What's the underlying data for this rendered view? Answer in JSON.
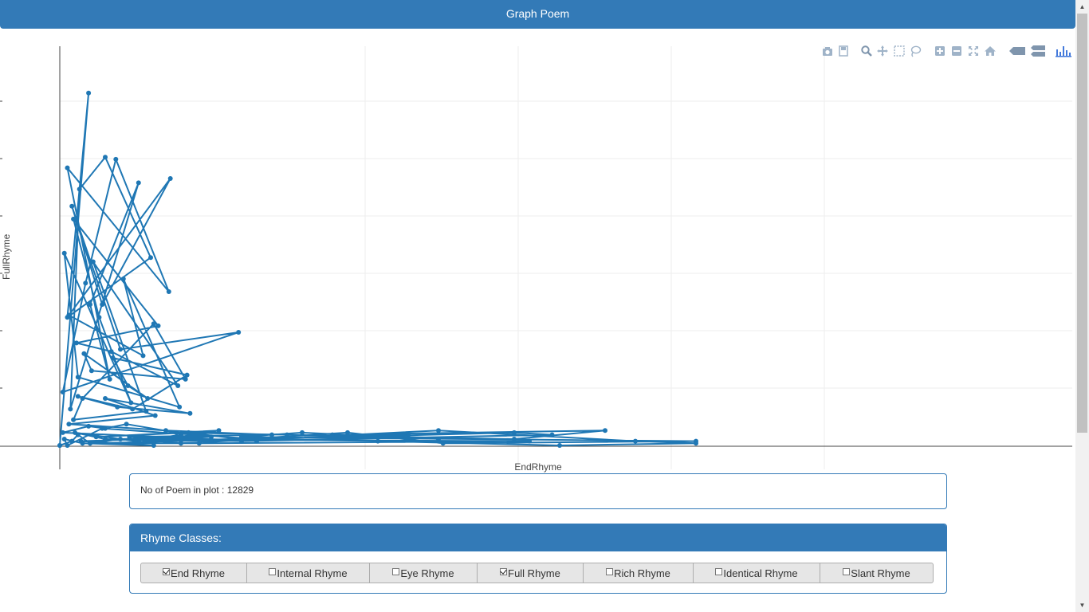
{
  "header": {
    "title": "Graph Poem"
  },
  "colors": {
    "accent": "#337ab7",
    "series": "#1f77b4",
    "grid": "#eeeeee"
  },
  "modebar": {
    "icons": [
      "camera-icon",
      "save-icon",
      "zoom-icon",
      "pan-icon",
      "box-select-icon",
      "lasso-icon",
      "zoom-in-icon",
      "zoom-out-icon",
      "autoscale-icon",
      "reset-axes-icon",
      "spike-lines-icon",
      "compare-hover-icon",
      "plotly-logo-icon"
    ]
  },
  "chart_data": {
    "type": "line",
    "xlabel": "EndRhyme",
    "ylabel": "FullRhyme",
    "grid": true,
    "series": [
      {
        "x": [
          0,
          19,
          5,
          60,
          30,
          13,
          7,
          52,
          20,
          33,
          5,
          72,
          37,
          17,
          2,
          118,
          40,
          8,
          28,
          73,
          6,
          55,
          42,
          79,
          12,
          3,
          47,
          26,
          9,
          65,
          11,
          34,
          78,
          22,
          57,
          9,
          15,
          62,
          83,
          21,
          16,
          58,
          45,
          35,
          84,
          48,
          12,
          38,
          86,
          30,
          63,
          6,
          70,
          140,
          46,
          100,
          190,
          253,
          420,
          120,
          160,
          250,
          180,
          360,
          300,
          150,
          77,
          44,
          30,
          19,
          2,
          130,
          85,
          24,
          105,
          62,
          230,
          56,
          80,
          50,
          10,
          30,
          310,
          92,
          20,
          300,
          325,
          120,
          50,
          80,
          250,
          380,
          420,
          330,
          210,
          130,
          28,
          5,
          3,
          15,
          62,
          14,
          100,
          40,
          20,
          12,
          8,
          0
        ],
        "y": [
          0,
          165,
          60,
          88,
          135,
          120,
          17,
          123,
          66,
          31,
          130,
          72,
          134,
          76,
          25,
          53,
          45,
          112,
          66,
          125,
          61,
          42,
          78,
          18,
          32,
          90,
          20,
          60,
          106,
          56,
          48,
          44,
          28,
          86,
          16,
          12,
          22,
          57,
          31,
          35,
          43,
          22,
          28,
          41,
          33,
          17,
          23,
          18,
          15,
          22,
          14,
          10,
          7,
          5,
          4,
          2,
          6,
          1,
          2,
          4,
          6,
          3,
          5,
          7,
          3,
          5,
          6,
          10,
          8,
          9,
          6,
          2,
          6,
          4,
          7,
          2,
          5,
          2,
          5,
          2,
          6,
          3,
          2,
          1,
          1,
          6,
          5,
          2,
          3,
          1,
          7,
          2,
          1,
          0,
          2,
          3,
          8,
          0,
          3,
          1,
          0,
          2,
          4,
          3,
          1,
          5,
          2,
          0
        ]
      }
    ]
  },
  "info": {
    "label": "No of Poem in plot : 12829"
  },
  "rhyme_classes": {
    "title": "Rhyme Classes:",
    "options": [
      {
        "label": "End Rhyme",
        "checked": true
      },
      {
        "label": "Internal Rhyme",
        "checked": false
      },
      {
        "label": "Eye Rhyme",
        "checked": false
      },
      {
        "label": "Full Rhyme",
        "checked": true
      },
      {
        "label": "Rich Rhyme",
        "checked": false
      },
      {
        "label": "Identical Rhyme",
        "checked": false
      },
      {
        "label": "Slant Rhyme",
        "checked": false
      }
    ]
  }
}
